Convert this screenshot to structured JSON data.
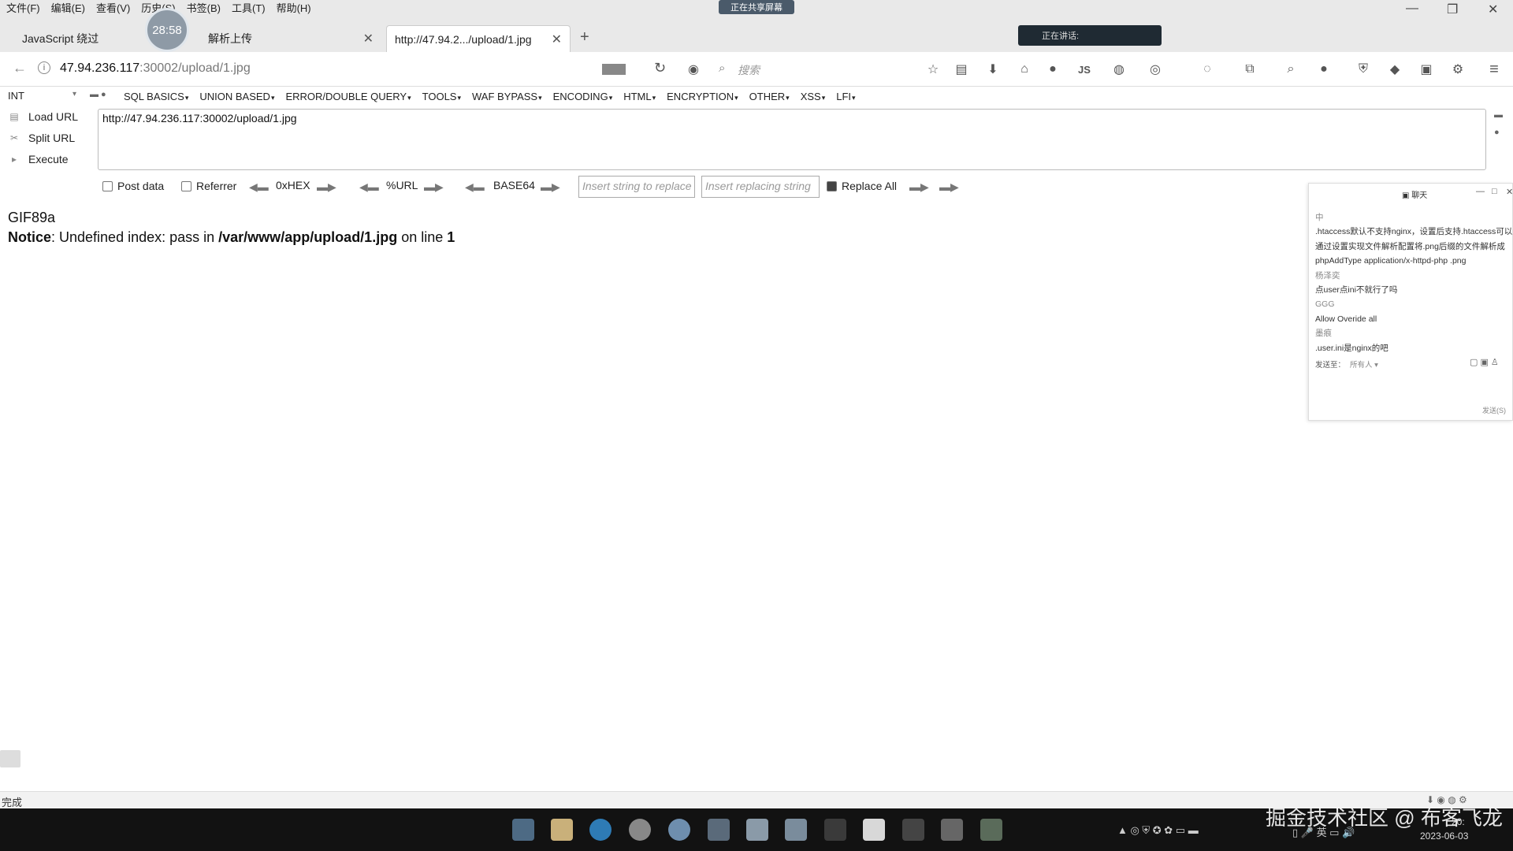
{
  "menu": [
    "文件(F)",
    "编辑(E)",
    "查看(V)",
    "历史(S)",
    "书签(B)",
    "工具(T)",
    "帮助(H)"
  ],
  "recording_timer": "28:58",
  "share_banner": "正在共享屏幕",
  "speaking_indicator": "正在讲话:",
  "tabs": [
    {
      "title": "JavaScript 绕过"
    },
    {
      "title": "解析上传"
    },
    {
      "title": "http://47.94.2.../upload/1.jpg"
    }
  ],
  "address": {
    "host": "47.94.236.117",
    "rest": ":30002/upload/1.jpg"
  },
  "search_placeholder": "搜索",
  "hackbar": {
    "select_value": "INT",
    "menu": [
      "SQL BASICS",
      "UNION BASED",
      "ERROR/DOUBLE QUERY",
      "TOOLS",
      "WAF BYPASS",
      "ENCODING",
      "HTML",
      "ENCRYPTION",
      "OTHER",
      "XSS",
      "LFI"
    ],
    "load_url": "Load URL",
    "split_url": "Split URL",
    "execute": "Execute",
    "url_value": "http://47.94.236.117:30002/upload/1.jpg",
    "post_data": "Post data",
    "referrer": "Referrer",
    "hex": "0xHEX",
    "url_enc": "%URL",
    "base64": "BASE64",
    "insert_to_replace": "Insert string to replace",
    "insert_replacing": "Insert replacing string",
    "replace_all": "Replace All"
  },
  "page": {
    "line1": "GIF89a",
    "notice_label": "Notice",
    "notice_text": ": Undefined index: pass in ",
    "notice_path": "/var/www/app/upload/1.jpg",
    "notice_mid": " on line ",
    "notice_line": "1"
  },
  "chat": {
    "title": "聊天",
    "messages": [
      "中",
      ".htaccess默认不支持nginx，设置后支持.htaccess可以",
      "通过设置实现文件解析配置将.png后缀的文件解析成",
      "phpAddType application/x-httpd-php .png",
      "杨泽奕",
      "点user点ini不就行了吗",
      "GGG",
      "Allow Overide all",
      "墨痕",
      ".user.ini是nginx的吧"
    ],
    "send_to_label": "发送至：",
    "send_to_value": "所有人",
    "send_button": "发送(S)"
  },
  "status_text": "完成",
  "watermark": "掘金技术社区 @ 布客飞龙",
  "clock": {
    "time": "20:",
    "date": "2023-06-03"
  },
  "colors": {
    "taskbar": "#121212",
    "chrome": "#e9e9e9"
  }
}
